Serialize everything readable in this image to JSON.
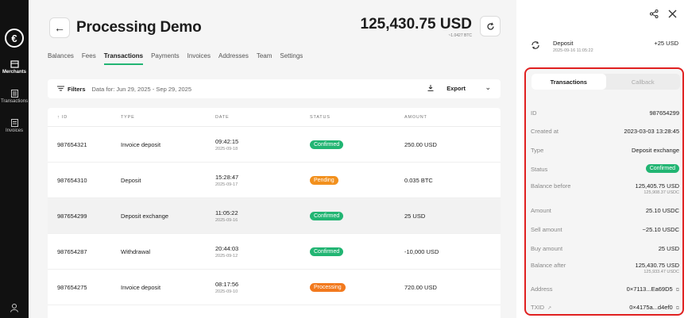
{
  "rail": {
    "logo": "€",
    "items": [
      {
        "label": "Merchants",
        "icon": "store-icon"
      },
      {
        "label": "Transactions",
        "icon": "list-icon"
      },
      {
        "label": "Invoices",
        "icon": "doc-icon"
      }
    ]
  },
  "header": {
    "title": "Processing Demo",
    "balance": "125,430.75 USD",
    "balance_sub": "~1.0427 BTC"
  },
  "tabs": [
    "Balances",
    "Fees",
    "Transactions",
    "Payments",
    "Invoices",
    "Addresses",
    "Team",
    "Settings"
  ],
  "active_tab": "Transactions",
  "filter": {
    "label": "Filters",
    "range": "Data for: Jun 29, 2025 - Sep 29, 2025",
    "export": "Export"
  },
  "table": {
    "headers": [
      "↑ ID",
      "TYPE",
      "DATE",
      "STATUS",
      "AMOUNT"
    ],
    "rows": [
      {
        "id": "987654321",
        "type": "Invoice deposit",
        "time": "09:42:15",
        "date": "2025-09-18",
        "status": "Confirmed",
        "amount": "250.00 USD"
      },
      {
        "id": "987654310",
        "type": "Deposit",
        "time": "15:28:47",
        "date": "2025-09-17",
        "status": "Pending",
        "amount": "0.035 BTC"
      },
      {
        "id": "987654299",
        "type": "Deposit exchange",
        "time": "11:05:22",
        "date": "2025-09-16",
        "status": "Confirmed",
        "amount": "25 USD"
      },
      {
        "id": "987654287",
        "type": "Withdrawal",
        "time": "20:44:03",
        "date": "2025-09-12",
        "status": "Confirmed",
        "amount": "-10,000 USD"
      },
      {
        "id": "987654275",
        "type": "Invoice deposit",
        "time": "08:17:56",
        "date": "2025-09-10",
        "status": "Processing",
        "amount": "720.00 USD"
      }
    ]
  },
  "panel": {
    "deposit_title": "Deposit",
    "deposit_date": "2025-09-16 11:05:22",
    "deposit_amount": "+25 USD",
    "tabs": [
      "Transactions",
      "Callback"
    ],
    "details": [
      {
        "label": "ID",
        "value": "987654299"
      },
      {
        "label": "Created at",
        "value": "2023-03-03 13:28:45"
      },
      {
        "label": "Type",
        "value": "Deposit exchange"
      },
      {
        "label": "Status",
        "value": "Confirmed"
      },
      {
        "label": "Balance before",
        "value": "125,405.75 USD",
        "sub": "125,908.37 USDC"
      },
      {
        "label": "Amount",
        "value": "25.10 USDC"
      },
      {
        "label": "Sell amount",
        "value": "−25.10 USDC"
      },
      {
        "label": "Buy amount",
        "value": "25 USD"
      },
      {
        "label": "Balance after",
        "value": "125,430.75 USD",
        "sub": "125,933.47 USDC"
      },
      {
        "label": "Address",
        "value": "0×7113...Ea69D5"
      },
      {
        "label": "TXID",
        "value": "0×4175a...d4ef0"
      }
    ]
  },
  "colors": {
    "accent": "#22b573",
    "pending": "#f2901d",
    "highlight_border": "#e02020"
  }
}
